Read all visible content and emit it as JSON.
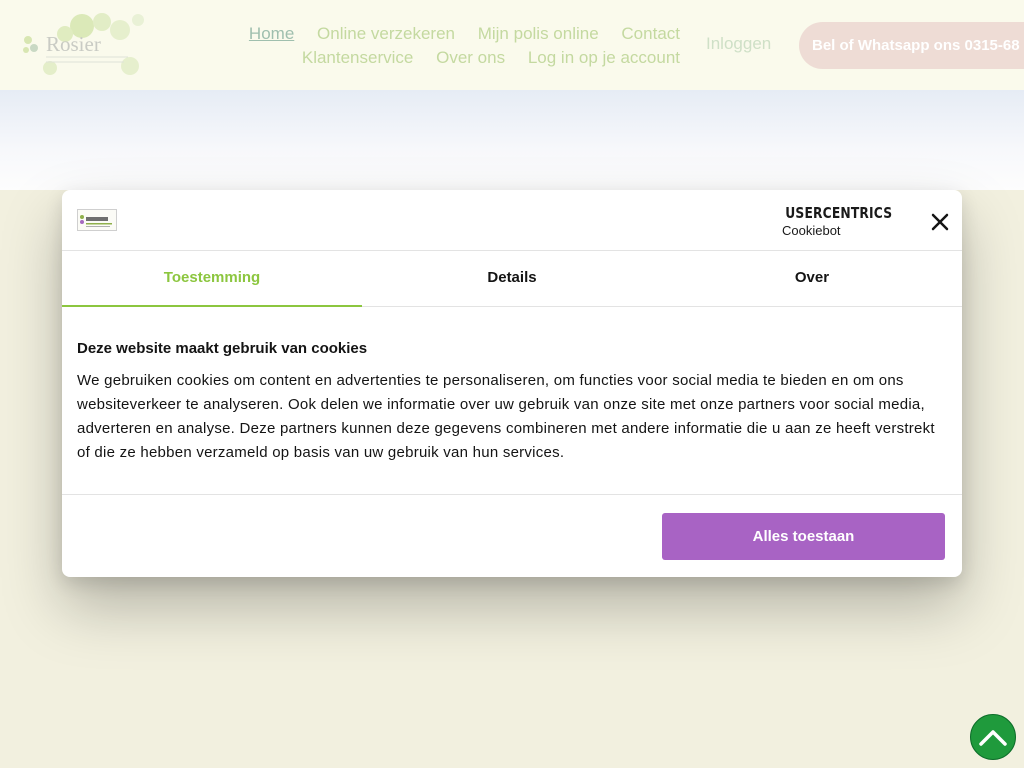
{
  "header": {
    "logo_text": "Rosier",
    "nav": {
      "row1": [
        "Home",
        "Online verzekeren",
        "Mijn polis online",
        "Contact"
      ],
      "row2": [
        "Klantenservice",
        "Over ons",
        "Log in op je account"
      ]
    },
    "login_label": "Inloggen",
    "call_button_label": "Bel of Whatsapp ons 0315-68"
  },
  "cookie_dialog": {
    "brand_top": "USERCENTRICS",
    "brand_bottom": "Cookiebot",
    "tabs": [
      {
        "label": "Toestemming",
        "active": true
      },
      {
        "label": "Details",
        "active": false
      },
      {
        "label": "Over",
        "active": false
      }
    ],
    "title": "Deze website maakt gebruik van cookies",
    "body": "We gebruiken cookies om content en advertenties te personaliseren, om functies voor social media te bieden en om ons websiteverkeer te analyseren. Ook delen we informatie over uw gebruik van onze site met onze partners voor social media, adverteren en analyse. Deze partners kunnen deze gegevens combineren met andere informatie die u aan ze heeft verstrekt of die ze hebben verzameld op basis van uw gebruik van hun services.",
    "allow_all_label": "Alles toestaan"
  },
  "colors": {
    "accent_green": "#8cc63f",
    "allow_button": "#a863c4",
    "scroll_top": "#1f9a3c"
  },
  "icons": {
    "close": "close-icon",
    "scroll_top": "chevron-up-icon",
    "brand": "shield-check-icon"
  }
}
